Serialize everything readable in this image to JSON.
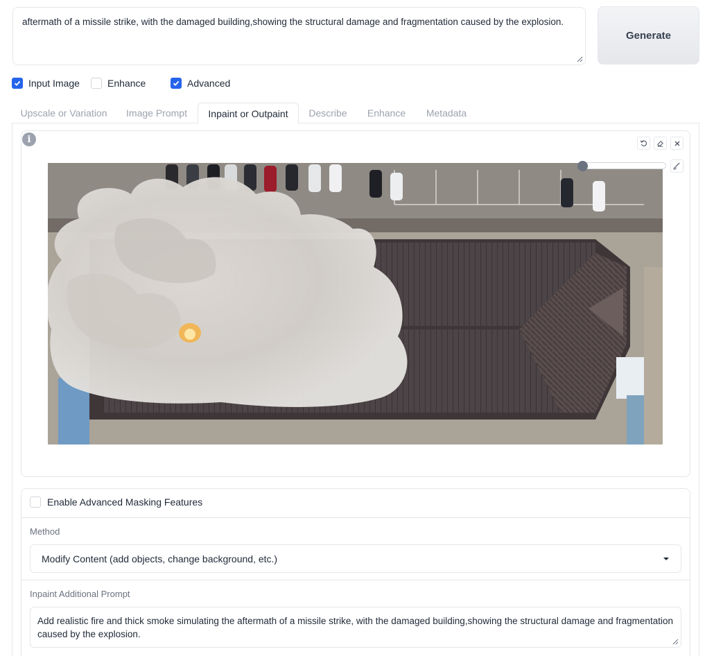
{
  "prompt": {
    "value": "aftermath of a missile strike, with the damaged building,showing the structural damage and fragmentation caused by the explosion."
  },
  "generate_label": "Generate",
  "options": [
    {
      "label": "Input Image",
      "checked": true
    },
    {
      "label": "Enhance",
      "checked": false
    },
    {
      "label": "Advanced",
      "checked": true
    }
  ],
  "tabs": [
    {
      "label": "Upscale or Variation",
      "active": false
    },
    {
      "label": "Image Prompt",
      "active": false
    },
    {
      "label": "Inpaint or Outpaint",
      "active": true
    },
    {
      "label": "Describe",
      "active": false
    },
    {
      "label": "Enhance",
      "active": false
    },
    {
      "label": "Metadata",
      "active": false
    }
  ],
  "editor": {
    "info_icon": "info-icon",
    "tools": [
      "undo-icon",
      "eraser-icon",
      "close-icon"
    ],
    "brush_icon": "brush-icon",
    "brush_size_fraction": 0.03
  },
  "masking": {
    "enable_label": "Enable Advanced Masking Features",
    "enable_checked": false,
    "method_label": "Method",
    "method_value": "Modify Content (add objects, change background, etc.)",
    "inpaint_prompt_label": "Inpaint Additional Prompt",
    "inpaint_prompt_value": "Add realistic fire and thick smoke simulating the aftermath of a missile strike, with the damaged building,showing the structural damage and fragmentation caused by the explosion."
  },
  "colors": {
    "accent": "#2563eb",
    "border": "#e5e7eb",
    "muted_text": "#9ca3af"
  }
}
